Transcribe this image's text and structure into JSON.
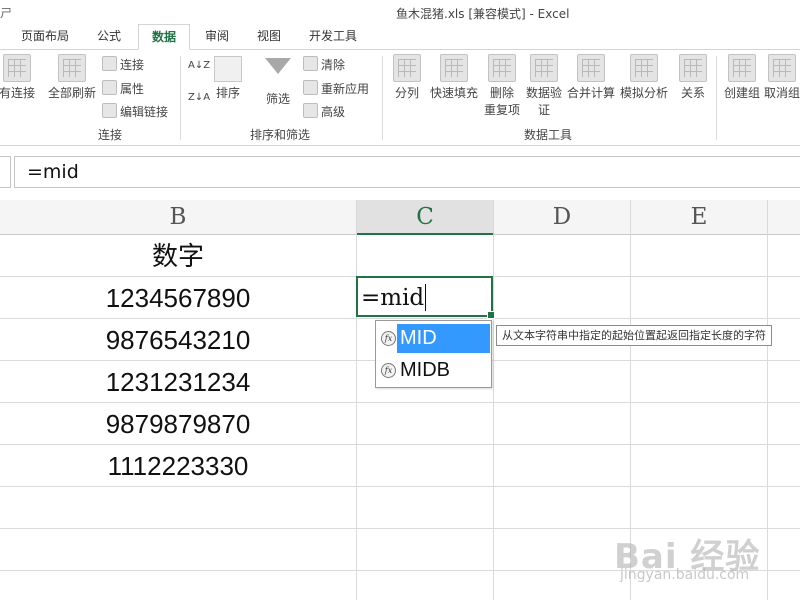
{
  "title_bar": {
    "lead": "ㄕ",
    "title": "鱼木混猪.xls  [兼容模式] - Excel"
  },
  "tabs": [
    "页面布局",
    "公式",
    "数据",
    "审阅",
    "视图",
    "开发工具"
  ],
  "ribbon": {
    "connections": {
      "existing": "有连接",
      "refresh_all": "全部刷新",
      "connect": "连接",
      "properties": "属性",
      "edit_links": "编辑链接",
      "group_label": "连接"
    },
    "sort_filter": {
      "az": "A↓Z",
      "za": "Z↓A",
      "sort": "排序",
      "filter": "筛选",
      "clear": "清除",
      "reapply": "重新应用",
      "advanced": "高级",
      "group_label": "排序和筛选"
    },
    "data_tools": {
      "split": "分列",
      "flash_fill": "快速填充",
      "remove_dup_1": "删除",
      "remove_dup_2": "重复项",
      "validation_1": "数据验",
      "validation_2": "证",
      "consolidate": "合并计算",
      "what_if": "模拟分析",
      "relations": "关系",
      "group_label": "数据工具"
    },
    "outline": {
      "group": "创建组",
      "ungroup": "取消组"
    }
  },
  "formula_bar": {
    "value": "=mid"
  },
  "columns": [
    "B",
    "C",
    "D",
    "E"
  ],
  "column_b": [
    "数字",
    "1234567890",
    "9876543210",
    "1231231234",
    "9879879870",
    "1112223330"
  ],
  "active_cell": {
    "value": "=mid"
  },
  "autocomplete": {
    "items": [
      "MID",
      "MIDB"
    ],
    "tooltip": "从文本字符串中指定的起始位置起返回指定长度的字符"
  },
  "watermark": {
    "text": "Bai 经验",
    "url": "jingyan.baidu.com"
  }
}
